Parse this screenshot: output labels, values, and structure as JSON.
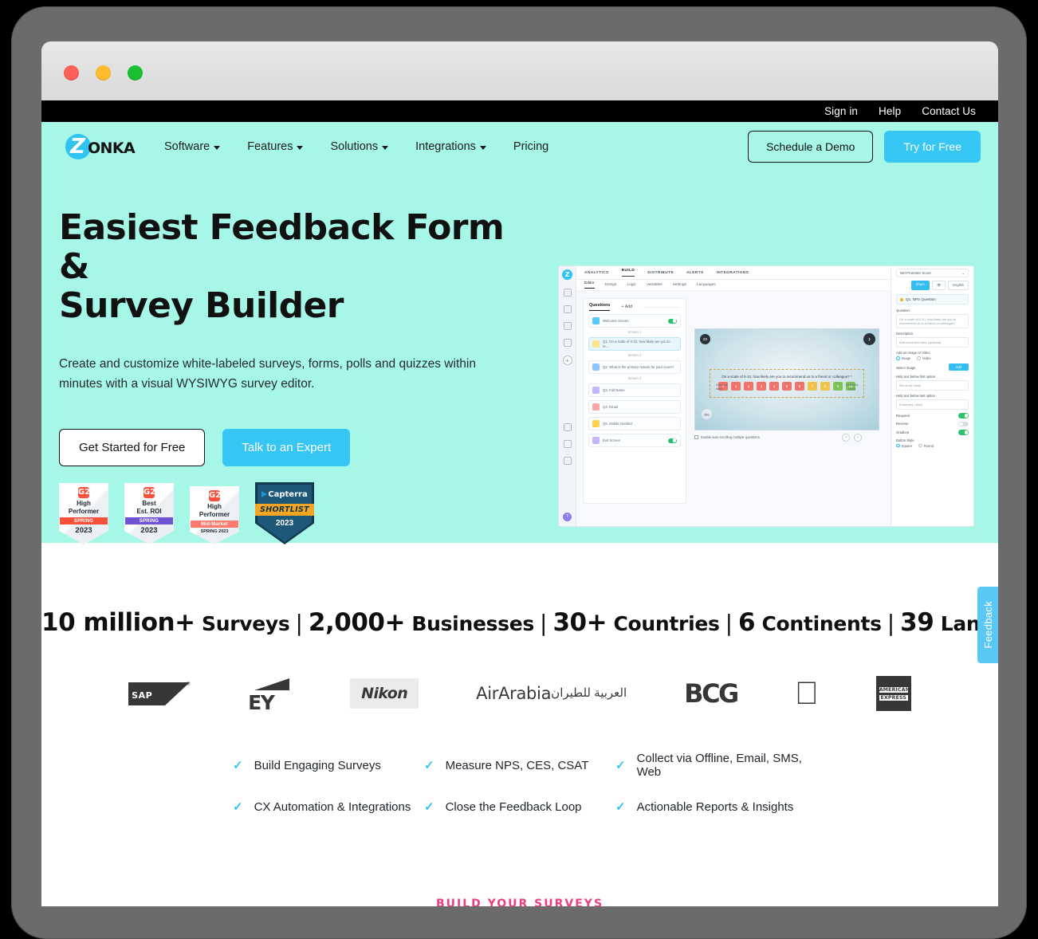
{
  "window": {
    "traffic_lights": [
      "close-red",
      "minimize-yellow",
      "maximize-green"
    ]
  },
  "utility_bar": {
    "links": [
      {
        "label": "Sign in"
      },
      {
        "label": "Help"
      },
      {
        "label": "Contact Us"
      }
    ]
  },
  "brand": {
    "logo_z": "Z",
    "logo_text": "ONKA",
    "accent_cyan": "#35c6f4",
    "hero_bg": "#a6f7e8",
    "pink": "#ee3d7f"
  },
  "nav": {
    "items": [
      {
        "label": "Software",
        "has_caret": true
      },
      {
        "label": "Features",
        "has_caret": true
      },
      {
        "label": "Solutions",
        "has_caret": true
      },
      {
        "label": "Integrations",
        "has_caret": true
      },
      {
        "label": "Pricing",
        "has_caret": false
      }
    ],
    "demo_button": "Schedule a Demo",
    "try_button": "Try for Free"
  },
  "hero": {
    "title_line1": "Easiest Feedback Form &",
    "title_line2": "Survey Builder",
    "subtitle": "Create and customize white-labeled surveys, forms, polls and quizzes within minutes with a visual WYSIWYG survey editor.",
    "primary_button": "Get Started for Free",
    "secondary_button": "Talk to an Expert"
  },
  "badges": [
    {
      "type": "g2",
      "logo": "G2",
      "line1": "High",
      "line2": "Performer",
      "ribbon": "SPRING",
      "ribbon_color": "#f8503c",
      "year": "2023",
      "sub": ""
    },
    {
      "type": "g2",
      "logo": "G2",
      "line1": "Best",
      "line2": "Est. ROI",
      "ribbon": "SPRING",
      "ribbon_color": "#6e54d4",
      "year": "2023",
      "sub": ""
    },
    {
      "type": "g2",
      "logo": "G2",
      "line1": "High",
      "line2": "Performer",
      "ribbon": "Mid-Market",
      "ribbon_color": "#fb7a6b",
      "year": "",
      "sub": "SPRING 2023"
    },
    {
      "type": "capterra",
      "title": "Capterra",
      "ribbon": "SHORTLIST",
      "year": "2023"
    }
  ],
  "product_mock": {
    "rail": {
      "logo": "Z",
      "avatar": "T",
      "plus": "+"
    },
    "top_tabs": [
      "ANALYTICS",
      "BUILD",
      "DISTRIBUTE",
      "ALERTS",
      "INTEGRATIONS"
    ],
    "active_top_tab": "BUILD",
    "sub_tabs": [
      "Editor",
      "Design",
      "Logic",
      "Variables",
      "Settings",
      "Languages"
    ],
    "active_sub_tab": "Editor",
    "questions_panel": {
      "tab_label": "Questions",
      "add_label": "+ Add",
      "rows": [
        {
          "label": "Welcome Screen",
          "chip": "#5ac8f5",
          "toggle": true,
          "selected": false,
          "screen": "Screen 1"
        },
        {
          "label": "Q1. On a scale of 0-10, how likely are you to re...",
          "chip": "#fde68a",
          "toggle": false,
          "selected": true,
          "screen": "Screen 2"
        },
        {
          "label": "Q2. What is the primary reason for your score?",
          "chip": "#93c5fd",
          "toggle": false,
          "selected": false,
          "screen": "Screen 3"
        },
        {
          "label": "Q3. Full Name",
          "chip": "#c4b5fd",
          "toggle": false,
          "selected": false,
          "screen": ""
        },
        {
          "label": "Q4. Email",
          "chip": "#fca5a5",
          "toggle": false,
          "selected": false,
          "screen": ""
        },
        {
          "label": "Q5. Mobile Number",
          "chip": "#fcd34d",
          "toggle": false,
          "selected": false,
          "screen": ""
        },
        {
          "label": "Exit Screen",
          "chip": "#c4b5fd",
          "toggle": true,
          "selected": false,
          "screen": ""
        }
      ]
    },
    "preview": {
      "avatar": "ZS",
      "progress": "0%",
      "question": "On a scale of 0-10, how likely are you to recommend us to a friend or colleague? *",
      "nps_labels": {
        "left": "Not at all likely",
        "right": "Extremely Likely"
      },
      "nps_values": [
        "0",
        "1",
        "2",
        "3",
        "4",
        "5",
        "6",
        "7",
        "8",
        "9",
        "10"
      ],
      "nps_colors": [
        "#f2736a",
        "#f2736a",
        "#f2736a",
        "#f2736a",
        "#f2736a",
        "#f2736a",
        "#f2736a",
        "#f2c34a",
        "#f2c34a",
        "#7cc356",
        "#7cc356"
      ],
      "next_icon": "chevron-right-icon"
    },
    "under_checkbox": "Enable auto-scrolling multiple questions",
    "right_panel": {
      "survey_select": "Net Promoter Score",
      "share_button": "Share",
      "preview_icon": "eye-icon",
      "language_button": "English",
      "section_title": "Q1. NPS Question",
      "question_label": "Question:",
      "question_value": "On a scale of 0-10, how likely are you to recommend us to a friend or colleague?",
      "description_label": "Description",
      "description_placeholder": "Add some text here (optional)",
      "media_label": "Add an Image or Video",
      "media_options": [
        "Image",
        "Video"
      ],
      "media_selected": "Image",
      "select_image_label": "Select Image",
      "add_button": "Add",
      "help_first_label": "Help text below first option",
      "help_first_value": "Not at all Likely",
      "help_last_label": "Help text below last option",
      "help_last_value": "Extremely Likely",
      "toggles": [
        {
          "label": "Required",
          "on": true
        },
        {
          "label": "Reverse",
          "on": false
        },
        {
          "label": "Gradient",
          "on": true
        }
      ],
      "button_style_label": "Button Style",
      "button_style_options": [
        "Square",
        "Round"
      ],
      "button_style_selected": "Square"
    }
  },
  "feedback_tab": {
    "label": "Feedback"
  },
  "stats": {
    "items": [
      {
        "num": "10 million+",
        "word": "Surveys"
      },
      {
        "num": "2,000+",
        "word": "Businesses"
      },
      {
        "num": "30+",
        "word": "Countries"
      },
      {
        "num": "6",
        "word": "Continents"
      },
      {
        "num": "39",
        "word": "Languages"
      }
    ],
    "separator": "|"
  },
  "logos": [
    {
      "name": "sap-logo",
      "text": "SAP",
      "reg": "®"
    },
    {
      "name": "ey-logo",
      "text": "EY"
    },
    {
      "name": "nikon-logo",
      "text": "Nikon"
    },
    {
      "name": "airarabia-logo",
      "text_en": "AirArabia",
      "text_ar": "العربية للطيران"
    },
    {
      "name": "bcg-logo",
      "text": "BCG"
    },
    {
      "name": "apple-logo",
      "glyph": ""
    },
    {
      "name": "amex-logo",
      "line1": "AMERICAN",
      "line2": "EXPRESS"
    }
  ],
  "features": [
    {
      "label": "Build Engaging Surveys"
    },
    {
      "label": "Measure NPS, CES, CSAT"
    },
    {
      "label": "Collect via Offline, Email, SMS, Web"
    },
    {
      "label": "CX Automation & Integrations"
    },
    {
      "label": "Close the Feedback Loop"
    },
    {
      "label": "Actionable Reports & Insights"
    }
  ],
  "footer_teaser": {
    "label": "BUILD YOUR SURVEYS"
  }
}
